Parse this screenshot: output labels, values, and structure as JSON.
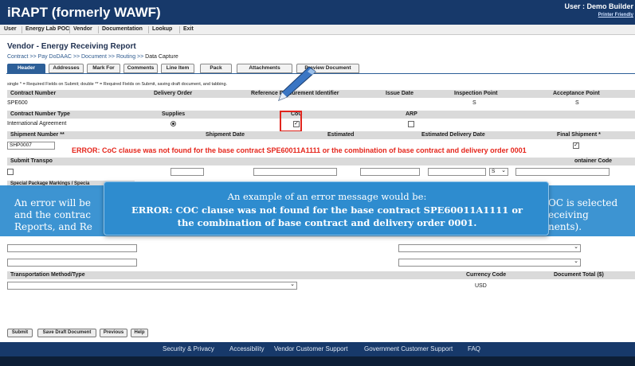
{
  "app": {
    "title": "iRAPT (formerly WAWF)",
    "user_label": "User : Demo Builder",
    "printer_friendly": "Printer Friendly"
  },
  "menu": [
    "User",
    "Energy Lab POC",
    "Vendor",
    "Documentation",
    "Lookup",
    "Exit"
  ],
  "page_title": "Vendor - Energy Receiving Report",
  "breadcrumb": {
    "trail": "Contract >> Pay DoDAAC >> Document >> Routing >> ",
    "current": "Data Capture"
  },
  "tabs": [
    "Header",
    "Addresses",
    "Mark For",
    "Comments",
    "Line Item",
    "Pack",
    "Attachments",
    "Preview Document"
  ],
  "required_note": "single * = Required Fields on Submit; double ** = Required Fields on Submit, saving draft document, and tabbing.",
  "row1": {
    "headers": [
      "Contract Number",
      "Delivery Order",
      "Reference Procurement Identifier",
      "Issue Date",
      "Inspection Point",
      "Acceptance Point"
    ],
    "values": {
      "contract_number": "SPE600",
      "inspection_point": "S",
      "acceptance_point": "S"
    }
  },
  "row2": {
    "headers": [
      "Contract Number Type",
      "Supplies",
      "CoC",
      "ARP"
    ],
    "values": {
      "contract_type": "International Agreement",
      "supplies_selected": true,
      "coc_checked": true,
      "arp_checked": false
    }
  },
  "row3": {
    "headers": [
      "Shipment Number **",
      "Shipment Date",
      "Estimated",
      "Estimated Delivery Date",
      "Final Shipment *"
    ],
    "values": {
      "shipment_number": "SHP0007",
      "final_shipment_checked": true
    }
  },
  "row4": {
    "headers": [
      "Submit Transpo",
      "ontainer Code"
    ],
    "values": {
      "select_value": "S"
    }
  },
  "special_markings_label": "Special Package Markings / Specia",
  "error_message": "ERROR: CoC clause was not found for the base contract SPE60011A1111 or the combination of base contract and delivery order 0001",
  "tooltip": {
    "back_left_lines": [
      "An error will be",
      "and the contrac",
      "Reports, and Re"
    ],
    "back_right_lines": [
      "OC is selected",
      "eceiving",
      "nents)."
    ],
    "line1": "An example of an error message would be:",
    "line2": "ERROR: COC clause was not found for the base contract SPE60011A1111 or",
    "line3": "the combination of base contract and delivery order 0001."
  },
  "transport": {
    "headers": [
      "Transportation Method/Type",
      "Currency Code",
      "Document Total ($)"
    ],
    "currency_value": "USD"
  },
  "buttons": [
    "Submit",
    "Save Draft Document",
    "Previous",
    "Help"
  ],
  "footer": [
    "Security & Privacy",
    "Accessibility",
    "Vendor Customer Support",
    "Government Customer Support",
    "FAQ"
  ],
  "colors": {
    "header_bg": "#17396a",
    "active_tab": "#2d5f98",
    "error": "#e5261c",
    "tooltip": "#2e8ccf"
  }
}
